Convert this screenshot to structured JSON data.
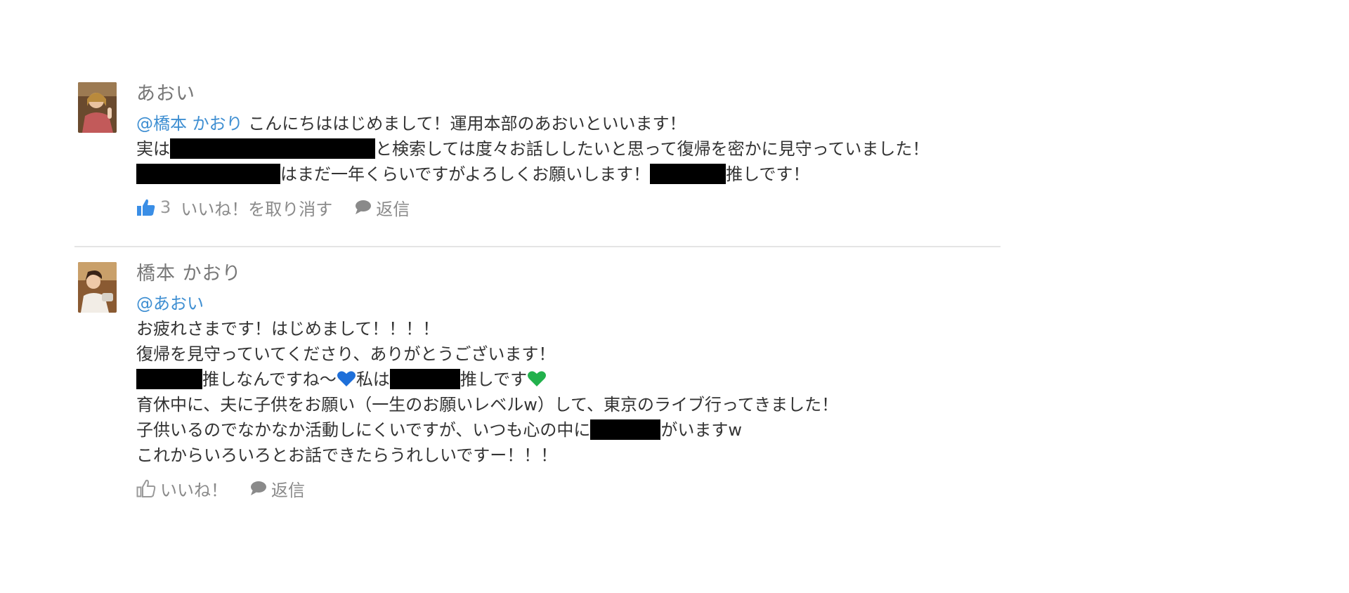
{
  "comments": [
    {
      "username": "あおい",
      "lines": [
        {
          "mention": "@橋本 かおり",
          "text_after_mention": " こんにちははじめまして！運用本部のあおいといいます！"
        },
        {
          "text_before": "実は",
          "text_after": "と検索しては度々お話ししたいと思って復帰を密かに見守っていました！"
        },
        {
          "text_after_first_redaction": "はまだ一年くらいですがよろしくお願いします！",
          "text_after_second_redaction": "推しです！"
        }
      ],
      "actions": {
        "like_count": "3",
        "like_label": "いいね！を取り消す",
        "like_state": "liked",
        "reply_label": "返信"
      }
    },
    {
      "username": "橋本 かおり",
      "lines": [
        {
          "mention": "@あおい"
        },
        {
          "text": "お疲れさまです！はじめまして！！！！"
        },
        {
          "text": "復帰を見守っていてくださり、ありがとうございます！"
        },
        {
          "text_after_first_redaction": "推しなんですね～",
          "text_middle": "私は",
          "text_after_second_redaction": "推しです"
        },
        {
          "text": "育休中に、夫に子供をお願い（一生のお願いレベルw）して、東京のライブ行ってきました！"
        },
        {
          "text_before": "子供いるのでなかなか活動しにくいですが、いつも心の中に",
          "text_after": "がいますw"
        },
        {
          "text": "これからいろいろとお話できたらうれしいですー！！！"
        }
      ],
      "actions": {
        "like_label": "いいね！",
        "like_state": "not-liked",
        "reply_label": "返信"
      }
    }
  ],
  "icons": {
    "like": "thumbs-up-icon",
    "reply": "speech-bubble-icon",
    "heart_blue": "blue-heart-icon",
    "heart_green": "green-heart-icon"
  },
  "colors": {
    "mention": "#3f8fd2",
    "text": "#333333",
    "username": "#777777",
    "action": "#8a8a8a",
    "liked_icon": "#3a8ee6",
    "heart_blue": "#1e6fd9",
    "heart_green": "#22b14c",
    "redaction": "#000000"
  }
}
